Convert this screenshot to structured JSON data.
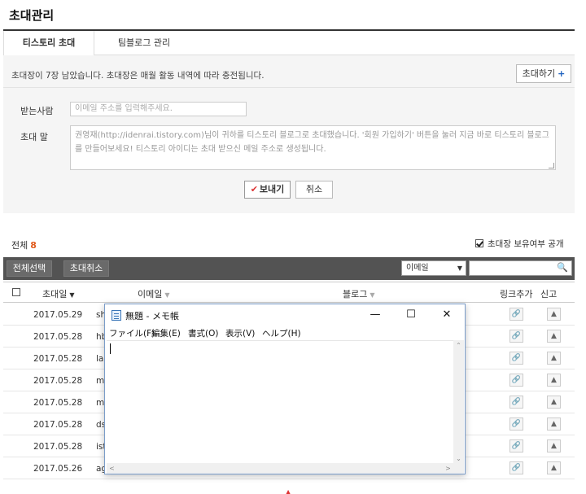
{
  "page": {
    "title": "초대관리"
  },
  "tabs": [
    {
      "label": "티스토리 초대",
      "active": true
    },
    {
      "label": "팀블로그 관리",
      "active": false
    }
  ],
  "form": {
    "notice": "초대장이 7장 남았습니다. 초대장은 매월 활동 내역에 따라 충전됩니다.",
    "invite_button": "초대하기",
    "invite_plus": "+",
    "recipient_label": "받는사람",
    "recipient_placeholder": "이메일 주소를 입력해주세요.",
    "message_label": "초대 말",
    "message_text": "권영재(http://idenrai.tistory.com)님이 귀하를 티스토리 블로그로 초대했습니다. '회원 가입하기' 버튼을 눌러 지금 바로 티스토리 블로그를 만들어보세요! 티스토리 아이디는 초대 받으신 메일 주소로 생성됩니다.",
    "send_button": "보내기",
    "send_check": "✔",
    "cancel_button": "취소"
  },
  "list": {
    "total_label": "전체",
    "total_count": "8",
    "public_label": "초대장 보유여부 공개",
    "public_checked": true,
    "select_all_button": "전체선택",
    "cancel_invite_button": "초대취소",
    "search_field_option": "이메일",
    "columns": {
      "date": "초대일",
      "email": "이메일",
      "blog": "블로그",
      "link": "링크추가",
      "report": "신고"
    },
    "rows": [
      {
        "date": "2017.05.29",
        "email": "sh"
      },
      {
        "date": "2017.05.28",
        "email": "hb"
      },
      {
        "date": "2017.05.28",
        "email": "la"
      },
      {
        "date": "2017.05.28",
        "email": "m"
      },
      {
        "date": "2017.05.28",
        "email": "m"
      },
      {
        "date": "2017.05.28",
        "email": "ds"
      },
      {
        "date": "2017.05.28",
        "email": "ist"
      },
      {
        "date": "2017.05.26",
        "email": "ag"
      }
    ]
  },
  "notepad": {
    "title": "無題 - メモ帳",
    "menus": [
      "ファイル(F)",
      "編集(E)",
      "書式(O)",
      "表示(V)",
      "ヘルプ(H)"
    ],
    "controls": {
      "minimize": "—",
      "maximize": "☐",
      "close": "✕"
    }
  },
  "colors": {
    "accent_orange": "#e05a1c",
    "toolbar_bg": "#535353",
    "check_red": "#d33333"
  }
}
